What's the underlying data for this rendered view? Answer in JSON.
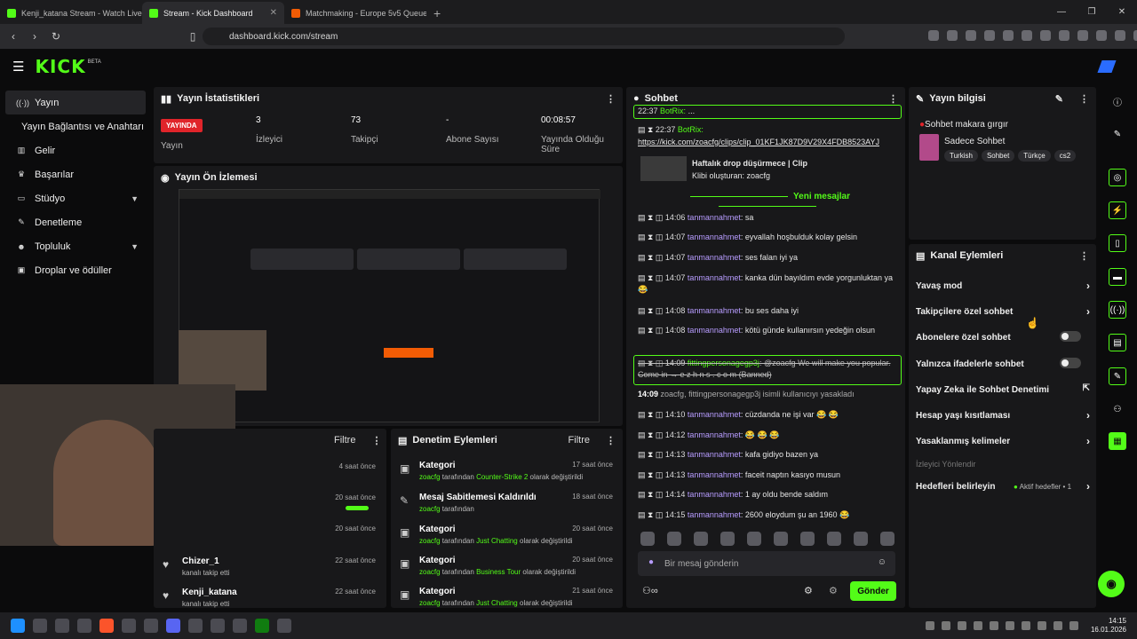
{
  "browser": {
    "tabs": [
      {
        "label": "Kenji_katana Stream - Watch Live"
      },
      {
        "label": "Stream - Kick Dashboard"
      },
      {
        "label": "Matchmaking - Europe 5v5 Queue - F"
      }
    ],
    "new_tab": "+",
    "url": "dashboard.kick.com/stream"
  },
  "header": {
    "logo": "KICK",
    "beta": "BETA"
  },
  "nav": {
    "items": [
      {
        "label": "Yayın",
        "icon": "antenna-icon"
      },
      {
        "label": "Yayın Bağlantısı ve Anahtarı"
      },
      {
        "label": "Gelir",
        "icon": "chart-icon"
      },
      {
        "label": "Başarılar",
        "icon": "trophy-icon"
      },
      {
        "label": "Stüdyo",
        "icon": "studio-icon"
      },
      {
        "label": "Denetleme",
        "icon": "wrench-icon"
      },
      {
        "label": "Topluluk",
        "icon": "people-icon"
      },
      {
        "label": "Droplar ve ödüller",
        "icon": "gift-icon"
      }
    ]
  },
  "stats": {
    "title": "Yayın İstatistikleri",
    "live_badge": "YAYINDA",
    "live_label": "Yayın",
    "viewers_value": "3",
    "viewers_label": "İzleyici",
    "followers_value": "73",
    "followers_label": "Takipçi",
    "subs_value": "-",
    "subs_label": "Abone Sayısı",
    "duration_value": "00:08:57",
    "duration_label": "Yayında Olduğu Süre"
  },
  "preview": {
    "title": "Yayın Ön İzlemesi"
  },
  "followers_panel": {
    "filter": "Filtre",
    "rows": [
      {
        "ago": "4 saat önce"
      },
      {
        "ago": "20 saat önce"
      },
      {
        "ago": "20 saat önce"
      },
      {
        "name": "Chizer_1",
        "sub": "kanalı takip etti",
        "ago": "22 saat önce"
      },
      {
        "name": "Kenji_katana",
        "sub": "kanalı takip etti",
        "ago": "22 saat önce"
      }
    ]
  },
  "moderation": {
    "title": "Denetim Eylemleri",
    "filter": "Filtre",
    "rows": [
      {
        "title": "Kategori",
        "user": "zoacfg",
        "mid": " tarafından ",
        "target": "Counter-Strike 2",
        "end": " olarak değiştirildi",
        "ago": "17 saat önce"
      },
      {
        "title": "Mesaj Sabitlemesi Kaldırıldı",
        "user": "zoacfg",
        "mid": " tarafından",
        "target": "",
        "end": "",
        "ago": "18 saat önce"
      },
      {
        "title": "Kategori",
        "user": "zoacfg",
        "mid": " tarafından ",
        "target": "Just Chatting",
        "end": " olarak değiştirildi",
        "ago": "20 saat önce"
      },
      {
        "title": "Kategori",
        "user": "zoacfg",
        "mid": " tarafından ",
        "target": "Business Tour",
        "end": " olarak değiştirildi",
        "ago": "20 saat önce"
      },
      {
        "title": "Kategori",
        "user": "zoacfg",
        "mid": " tarafından ",
        "target": "Just Chatting",
        "end": " olarak değiştirildi",
        "ago": "21 saat önce"
      }
    ]
  },
  "chat": {
    "title": "Sohbet",
    "top_msg": {
      "time": "22:37",
      "user": "BotRix:",
      "text": "..."
    },
    "bot_msg": {
      "time": "22:37",
      "user": "BotRix:"
    },
    "clip_link": "https://kick.com/zoacfg/clips/clip_01KF1JK87D9V29X4FDB8523AYJ",
    "clip_title": "Haftalık drop düşürmece | Clip",
    "clip_author": "Klibi oluşturan: zoacfg",
    "new_messages": "Yeni mesajlar",
    "messages": [
      {
        "time": "14:06",
        "user": "tanmannahmet",
        "text": ": sa"
      },
      {
        "time": "14:07",
        "user": "tanmannahmet",
        "text": ": eyvallah hoşbulduk kolay gelsin"
      },
      {
        "time": "14:07",
        "user": "tanmannahmet",
        "text": ": ses falan iyi ya"
      },
      {
        "time": "14:07",
        "user": "tanmannahmet",
        "text": ": kanka dün bayıldım evde yorgunluktan ya 😂"
      },
      {
        "time": "14:08",
        "user": "tanmannahmet",
        "text": ": bu ses daha iyi"
      },
      {
        "time": "14:08",
        "user": "tanmannahmet",
        "text": ": kötü günde kullanırsın yedeğin olsun"
      }
    ],
    "banned": {
      "time": "14:09",
      "user": "fittingpersonagegp3j",
      "text": ": @zoacfg We will make you popular. Come in → e z h n s . c o m",
      "status": "(Banned)"
    },
    "ban_notice": {
      "time": "14:09",
      "text": "zoacfg, fittingpersonagegp3j isimli kullanıcıyı yasakladı"
    },
    "messages2": [
      {
        "time": "14:10",
        "user": "tanmannahmet",
        "text": ": cüzdanda ne işi var 😂 😂"
      },
      {
        "time": "14:12",
        "user": "tanmannahmet",
        "text": ": 😂 😂 😂"
      },
      {
        "time": "14:13",
        "user": "tanmannahmet",
        "text": ": kafa gidiyo bazen ya"
      },
      {
        "time": "14:13",
        "user": "tanmannahmet",
        "text": ": faceit naptın kasıyo musun"
      },
      {
        "time": "14:14",
        "user": "tanmannahmet",
        "text": ": 1 ay oldu bende saldım"
      },
      {
        "time": "14:15",
        "user": "tanmannahmet",
        "text": ": 2600 eloydum şu an 1960 😂"
      }
    ],
    "input_placeholder": "Bir mesaj gönderin",
    "send": "Gönder"
  },
  "stream_info": {
    "title": "Yayın bilgisi",
    "stream_title": "Sohbet makara gırgır",
    "category": "Sadece Sohbet",
    "tags": [
      "Turkish",
      "Sohbet",
      "Türkçe",
      "cs2"
    ]
  },
  "channel_actions": {
    "title": "Kanal Eylemleri",
    "items": [
      {
        "label": "Yavaş mod",
        "kind": "arrow"
      },
      {
        "label": "Takipçilere özel sohbet",
        "kind": "arrow"
      },
      {
        "label": "Abonelere özel sohbet",
        "kind": "toggle"
      },
      {
        "label": "Yalnızca ifadelerle sohbet",
        "kind": "toggle"
      },
      {
        "label": "Yapay Zeka ile Sohbet Denetimi",
        "kind": "external"
      },
      {
        "label": "Hesap yaşı kısıtlaması",
        "kind": "arrow"
      },
      {
        "label": "Yasaklanmış kelimeler",
        "kind": "arrow"
      }
    ],
    "section": "İzleyici Yönlendir",
    "goals": "Hedefleri belirleyin",
    "goals_status": "Aktif hedefler • 1"
  },
  "taskbar": {
    "time": "14:15",
    "date": "16.01.2026"
  },
  "colors": {
    "accent": "#53fc18",
    "live": "#e0242a",
    "username": "#b79cff"
  }
}
